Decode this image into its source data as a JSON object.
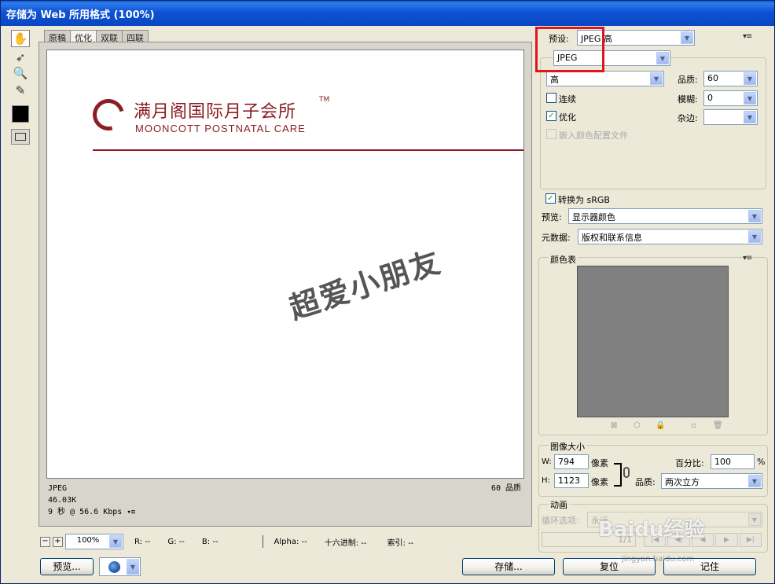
{
  "window": {
    "title": "存储为 Web 所用格式 (100%)"
  },
  "tabs": [
    {
      "label": "原稿",
      "active": false
    },
    {
      "label": "优化",
      "active": true
    },
    {
      "label": "双联",
      "active": false
    },
    {
      "label": "四联",
      "active": false
    }
  ],
  "preview": {
    "logo_zh": "满月阁国际月子会所",
    "logo_en": "MOONCOTT POSTNATAL CARE",
    "logo_tm": "TM",
    "watermark": "超爱小朋友",
    "format": "JPEG",
    "size": "46.03K",
    "time": "9 秒 @ 56.6 Kbps",
    "quality_note": "60 品质"
  },
  "status": {
    "zoom_minus": "−",
    "zoom_plus": "+",
    "zoom": "100%",
    "r": "R: --",
    "g": "G: --",
    "b": "B: --",
    "alpha": "Alpha: --",
    "hex": "十六进制: --",
    "index": "索引: --"
  },
  "buttons": {
    "preview": "预览...",
    "save": "存储...",
    "reset": "复位",
    "remember": "记住"
  },
  "settings": {
    "preset_label": "预设:",
    "preset_value": "JPEG 高",
    "format_value": "JPEG",
    "quality_level": "高",
    "quality_label": "品质:",
    "quality_value": "60",
    "progressive_label": "连续",
    "progressive_checked": false,
    "blur_label": "模糊:",
    "blur_value": "0",
    "optimized_label": "优化",
    "optimized_checked": true,
    "matte_label": "杂边:",
    "matte_value": "",
    "embed_profile_label": "嵌入颜色配置文件",
    "convert_srgb_label": "转换为 sRGB",
    "convert_srgb_checked": true,
    "preview_label": "预览:",
    "preview_value": "显示器颜色",
    "metadata_label": "元数据:",
    "metadata_value": "版权和联系信息",
    "check_mark": "✓"
  },
  "colortable": {
    "title": "颜色表",
    "icons": [
      "⊠",
      "⬡",
      "🔒",
      "▫",
      "🗑"
    ]
  },
  "imagesize": {
    "title": "图像大小",
    "w_label": "W:",
    "w_value": "794",
    "h_label": "H:",
    "h_value": "1123",
    "unit": "像素",
    "percent_label": "百分比:",
    "percent_value": "100",
    "percent_unit": "%",
    "quality_label": "品质:",
    "quality_value": "两次立方"
  },
  "animation": {
    "title": "动画",
    "loop_label": "循环选项:",
    "loop_value": "永远",
    "frame": "1/1",
    "nav": [
      "|◀",
      "◀|",
      "◀",
      "▶",
      "▶|"
    ]
  },
  "overlay": {
    "brand": "Baidu经验",
    "url": "jingyan.baidu.com"
  },
  "colors": {
    "brand_red": "#8b1e24",
    "highlight": "#e0161e",
    "titlebar": "#0a47c2"
  }
}
